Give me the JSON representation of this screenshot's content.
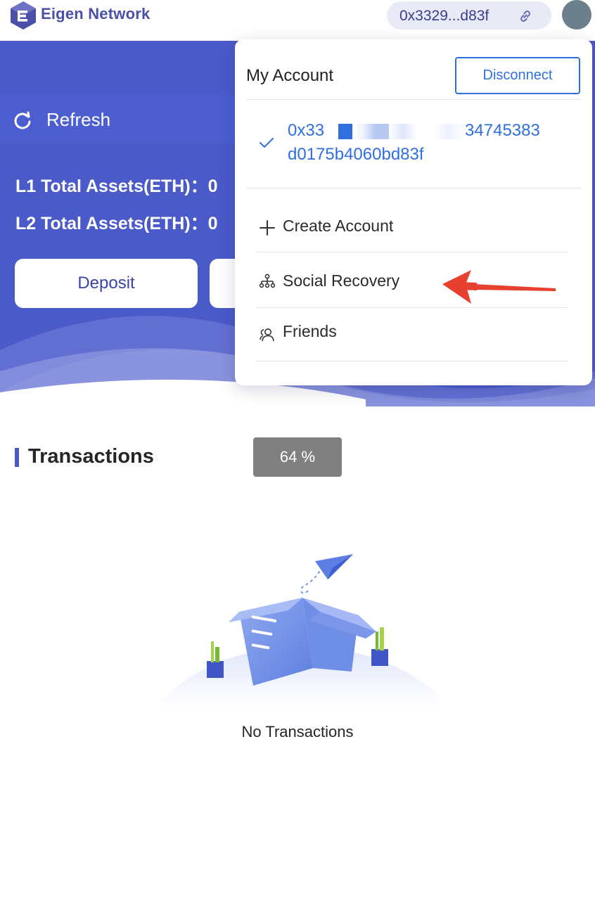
{
  "header": {
    "brand": "Eigen Network",
    "short_address": "0x3329...d83f"
  },
  "hero": {
    "refresh_label": "Refresh",
    "l1_label": "L1 Total Assets(ETH)：0",
    "l2_label": "L2 Total Assets(ETH)：0",
    "deposit_label": "Deposit"
  },
  "account_menu": {
    "title": "My Account",
    "disconnect_label": "Disconnect",
    "address_start": "0x33",
    "address_end": "34745383",
    "address_line2": "d0175b4060bd83f",
    "items": [
      {
        "label": "Create Account",
        "icon": "plus-icon"
      },
      {
        "label": "Social Recovery",
        "icon": "tree-network-icon"
      },
      {
        "label": "Friends",
        "icon": "people-icon"
      }
    ]
  },
  "transactions": {
    "title": "Transactions",
    "progress_text": "64 %",
    "progress_value": 0.64,
    "empty_text": "No Transactions"
  },
  "colors": {
    "brand": "#4a4fa8",
    "hero": "#4a5bc9",
    "link": "#2f6fe0",
    "annotation_arrow": "#e8402e"
  }
}
